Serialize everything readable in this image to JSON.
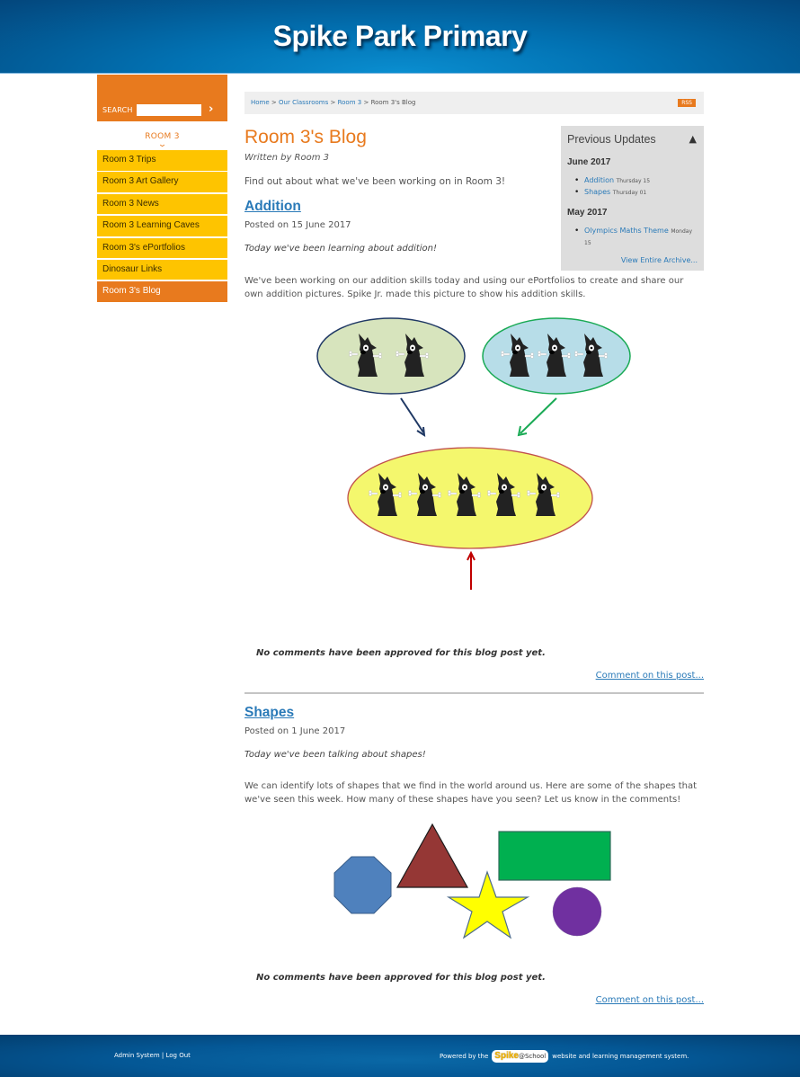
{
  "header": {
    "site_title": "Spike Park Primary"
  },
  "sidebar": {
    "search_label": "SEARCH",
    "search_placeholder": "",
    "search_go_icon": "chevron-right-icon",
    "room_title": "ROOM 3",
    "room_chevron_icon": "chevron-down-icon",
    "items": [
      {
        "label": "Room 3 Trips",
        "active": false
      },
      {
        "label": "Room 3 Art Gallery",
        "active": false
      },
      {
        "label": "Room 3 News",
        "active": false
      },
      {
        "label": "Room 3 Learning Caves",
        "active": false
      },
      {
        "label": "Room 3's ePortfolios",
        "active": false
      },
      {
        "label": "Dinosaur Links",
        "active": false
      },
      {
        "label": "Room 3's Blog",
        "active": true
      }
    ]
  },
  "breadcrumb": {
    "items": [
      "Home",
      "Our Classrooms",
      "Room 3"
    ],
    "separator": ">",
    "current": "Room 3's Blog",
    "rss_label": "RSS"
  },
  "page": {
    "title": "Room 3's Blog",
    "written_by": "Written by Room 3",
    "intro": "Find out about what we've been working on in Room 3!"
  },
  "previous_updates": {
    "title": "Previous Updates",
    "toggle_icon": "triangle-up-icon",
    "months": [
      {
        "label": "June 2017",
        "posts": [
          {
            "title": "Addition",
            "date": "Thursday 15"
          },
          {
            "title": "Shapes",
            "date": "Thursday 01"
          }
        ]
      },
      {
        "label": "May 2017",
        "posts": [
          {
            "title": "Olympics Maths Theme",
            "date": "Monday 15"
          }
        ]
      }
    ],
    "archive_link": "View Entire Archive..."
  },
  "posts": [
    {
      "title": "Addition",
      "posted_on": "Posted on 15 June 2017",
      "lead": "Today we've been learning about addition!",
      "body": "We've been working on our addition skills today and using our ePortfolios to create and share our own addition pictures. Spike Jr.  made this picture to show his addition skills.",
      "figure": {
        "left_group": 2,
        "right_group": 3,
        "total": 5
      },
      "no_comments": "No comments have been approved for this blog post yet.",
      "comment_link": "Comment on this post..."
    },
    {
      "title": "Shapes",
      "posted_on": "Posted on 1 June 2017",
      "lead": "Today we've been talking about shapes!",
      "body": "We can identify lots of shapes that we find in the world around us. Here are some of the shapes that we've seen this week. How many of these shapes have you seen? Let us know in the comments!",
      "figure": {
        "shapes": [
          "octagon",
          "triangle",
          "star",
          "rectangle",
          "circle"
        ]
      },
      "no_comments": "No comments have been approved for this blog post yet.",
      "comment_link": "Comment on this post..."
    }
  ],
  "footer": {
    "admin_link": "Admin System",
    "separator": "|",
    "logout_link": "Log Out",
    "powered_prefix": "Powered by the",
    "logo_spike": "Spike",
    "logo_school": "@School",
    "powered_suffix": "website and learning management system."
  },
  "colors": {
    "brand_orange": "#e87a1e",
    "nav_yellow": "#fec400",
    "header_blue": "#0272b3",
    "link_blue": "#2a7ab8"
  }
}
